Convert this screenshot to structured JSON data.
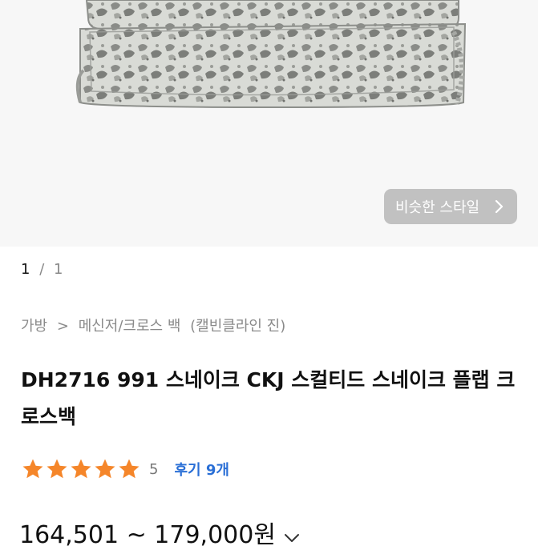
{
  "product_image": {
    "similar_style_button": "비슷한 스타일"
  },
  "pager": {
    "current": "1",
    "separator": "/",
    "total": "1"
  },
  "breadcrumb": {
    "level1": "가방",
    "separator": ">",
    "level2": "메신저/크로스 백",
    "brand": "(캘빈클라인 진)"
  },
  "product": {
    "title": "DH2716 991 스네이크 CKJ 스컬티드 스네이크 플랩 크로스백",
    "rating_value": "5",
    "stars": 5,
    "review_label": "후기 9개",
    "price_range": "164,501 ~ 179,000원"
  },
  "colors": {
    "star": "#f5862a",
    "review_link": "#2a6fd6"
  }
}
